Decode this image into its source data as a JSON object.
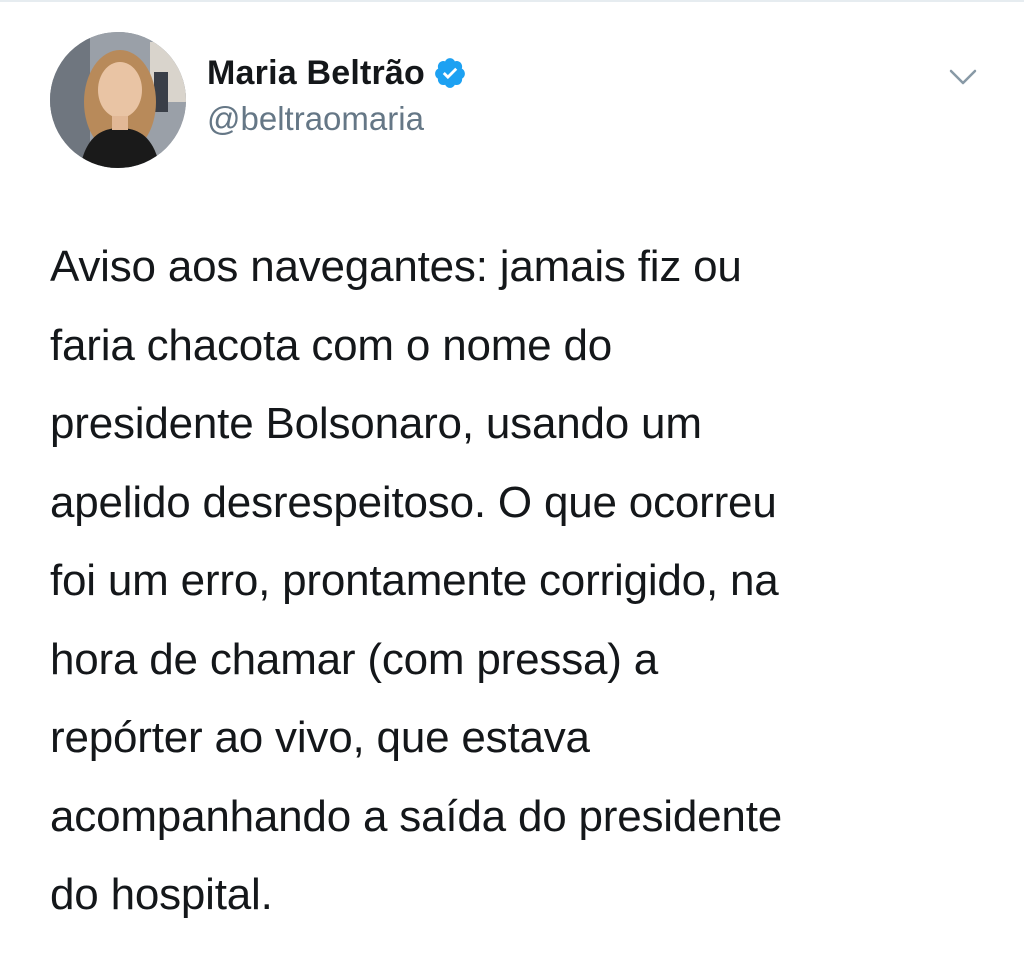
{
  "tweet": {
    "author": {
      "display_name": "Maria Beltrão",
      "handle": "@beltraomaria",
      "verified": true,
      "avatar_icon": "profile-photo"
    },
    "menu_icon": "chevron-down-icon",
    "text": "Aviso aos navegantes: jamais fiz ou\nfaria chacota com o nome do\npresidente Bolsonaro, usando um\napelido desrespeitoso. O que ocorreu\nfoi um erro, prontamente corrigido, na\nhora de chamar (com pressa) a\nrepórter ao vivo, que estava\nacompanhando a saída do presidente\ndo hospital."
  },
  "colors": {
    "text_primary": "#14171a",
    "text_secondary": "#657786",
    "verified_blue": "#1da1f2",
    "divider": "#e6ecf0"
  }
}
